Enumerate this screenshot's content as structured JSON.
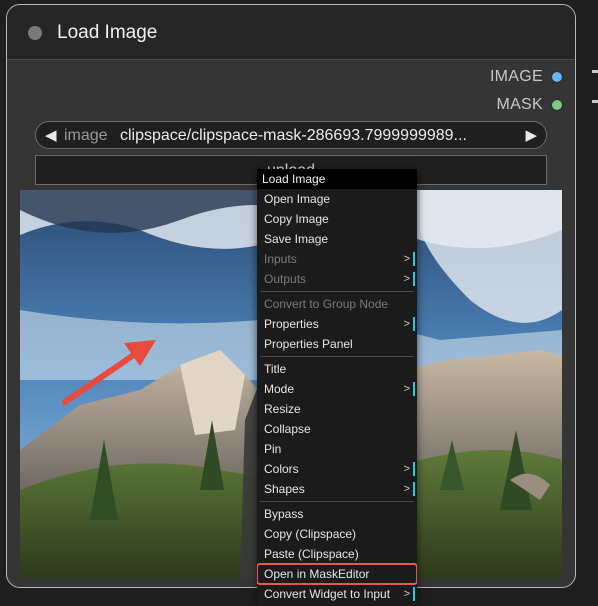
{
  "node": {
    "title": "Load Image",
    "outputs": [
      {
        "label": "IMAGE",
        "color": "#64b5f6"
      },
      {
        "label": "MASK",
        "color": "#81c784"
      }
    ],
    "image_widget": {
      "name": "image",
      "value": "clipspace/clipspace-mask-286693.7999999989...",
      "left_arrow": "◀",
      "right_arrow": "▶"
    },
    "upload_label": "upload"
  },
  "context_menu": {
    "title": "Load Image",
    "groups": [
      [
        {
          "label": "Open Image",
          "enabled": true,
          "submenu": false
        },
        {
          "label": "Copy Image",
          "enabled": true,
          "submenu": false
        },
        {
          "label": "Save Image",
          "enabled": true,
          "submenu": false
        },
        {
          "label": "Inputs",
          "enabled": false,
          "submenu": true
        },
        {
          "label": "Outputs",
          "enabled": false,
          "submenu": true
        }
      ],
      [
        {
          "label": "Convert to Group Node",
          "enabled": false,
          "submenu": false
        },
        {
          "label": "Properties",
          "enabled": true,
          "submenu": true
        },
        {
          "label": "Properties Panel",
          "enabled": true,
          "submenu": false
        }
      ],
      [
        {
          "label": "Title",
          "enabled": true,
          "submenu": false
        },
        {
          "label": "Mode",
          "enabled": true,
          "submenu": true
        },
        {
          "label": "Resize",
          "enabled": true,
          "submenu": false
        },
        {
          "label": "Collapse",
          "enabled": true,
          "submenu": false
        },
        {
          "label": "Pin",
          "enabled": true,
          "submenu": false
        },
        {
          "label": "Colors",
          "enabled": true,
          "submenu": true
        },
        {
          "label": "Shapes",
          "enabled": true,
          "submenu": true
        }
      ],
      [
        {
          "label": "Bypass",
          "enabled": true,
          "submenu": false
        },
        {
          "label": "Copy (Clipspace)",
          "enabled": true,
          "submenu": false
        },
        {
          "label": "Paste (Clipspace)",
          "enabled": true,
          "submenu": false
        },
        {
          "label": "Open in MaskEditor",
          "enabled": true,
          "submenu": false,
          "highlighted": true
        },
        {
          "label": "Convert Widget to Input",
          "enabled": true,
          "submenu": true
        }
      ]
    ],
    "submenu_glyph": ">"
  },
  "annotation": {
    "arrow_color": "#e84a3c",
    "highlight_color": "#e25a50"
  }
}
